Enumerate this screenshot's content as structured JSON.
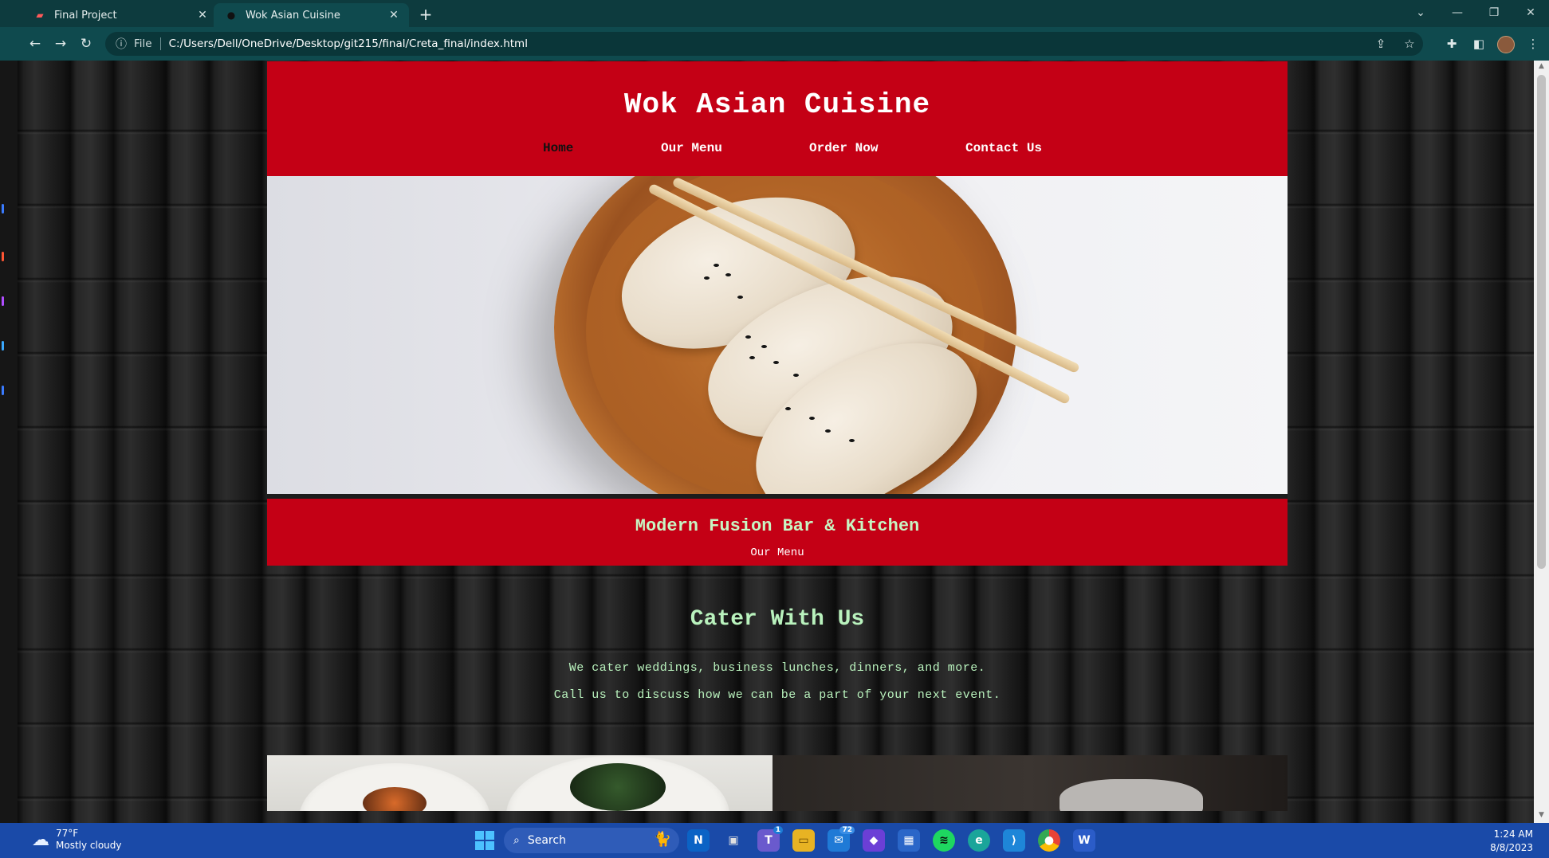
{
  "browser": {
    "tabs": [
      {
        "title": "Final Project",
        "active": false
      },
      {
        "title": "Wok Asian Cuisine",
        "active": true
      }
    ],
    "address": {
      "scheme_label": "File",
      "url": "C:/Users/Dell/OneDrive/Desktop/git215/final/Creta_final/index.html"
    }
  },
  "site": {
    "title": "Wok Asian Cuisine",
    "nav": [
      {
        "label": "Home",
        "current": true
      },
      {
        "label": "Our Menu",
        "current": false
      },
      {
        "label": "Order Now",
        "current": false
      },
      {
        "label": "Contact Us",
        "current": false
      }
    ],
    "banner": {
      "title": "Modern Fusion Bar & Kitchen",
      "link": "Our Menu"
    },
    "cater": {
      "title": "Cater With Us",
      "line1": "We cater weddings, business lunches, dinners, and more.",
      "line2": "Call us to discuss how we can be a part of your next event."
    }
  },
  "taskbar": {
    "weather": {
      "temp": "77°F",
      "condition": "Mostly cloudy"
    },
    "search_label": "Search",
    "badges": {
      "teams": "1",
      "mail": "72"
    },
    "time": "1:24 AM",
    "date": "8/8/2023"
  },
  "colors": {
    "brand_red": "#c40015",
    "mint_text": "#b9f2bd",
    "chrome_teal": "#0f4a4e",
    "taskbar_blue": "#1a4aa8"
  }
}
